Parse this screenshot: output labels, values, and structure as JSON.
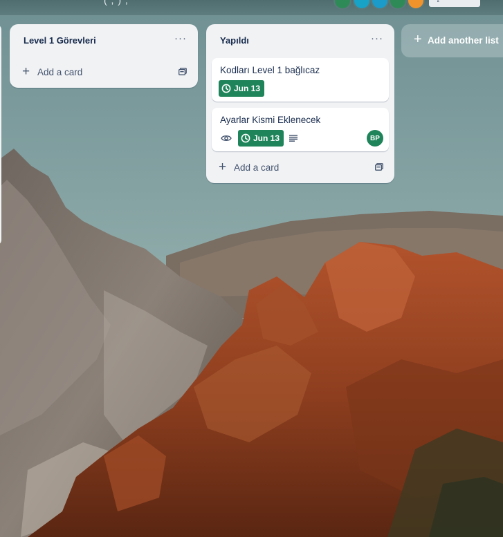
{
  "header": {
    "clipped_text": "( , ) ,",
    "share_label": "⇪"
  },
  "lists": [
    {
      "title": "Level 1 Görevleri",
      "menu": "···",
      "add_card": "Add a card",
      "cards": []
    },
    {
      "title": "Yapıldı",
      "menu": "···",
      "add_card": "Add a card",
      "cards": [
        {
          "title": "Kodları Level 1 bağlıcaz",
          "due": "Jun 13"
        },
        {
          "title": "Ayarlar Kismi Eklenecek",
          "due": "Jun 13",
          "member": "BP",
          "has_watch": true,
          "has_description": true
        }
      ]
    }
  ],
  "add_list": {
    "plus": "+",
    "label": "Add another list"
  },
  "colors": {
    "due_green": "#1f845a",
    "member_green": "#1f845a",
    "list_bg": "#f1f2f4",
    "avatar_colors": [
      "#2e8b57",
      "#17a2c8",
      "#1a9bc9",
      "#2e8b57",
      "#f0932b"
    ]
  },
  "icons": {
    "menu": "more-horizontal-icon",
    "plus": "plus-icon",
    "template": "card-template-icon",
    "clock": "clock-icon",
    "watch": "eye-icon",
    "description": "description-lines-icon"
  }
}
